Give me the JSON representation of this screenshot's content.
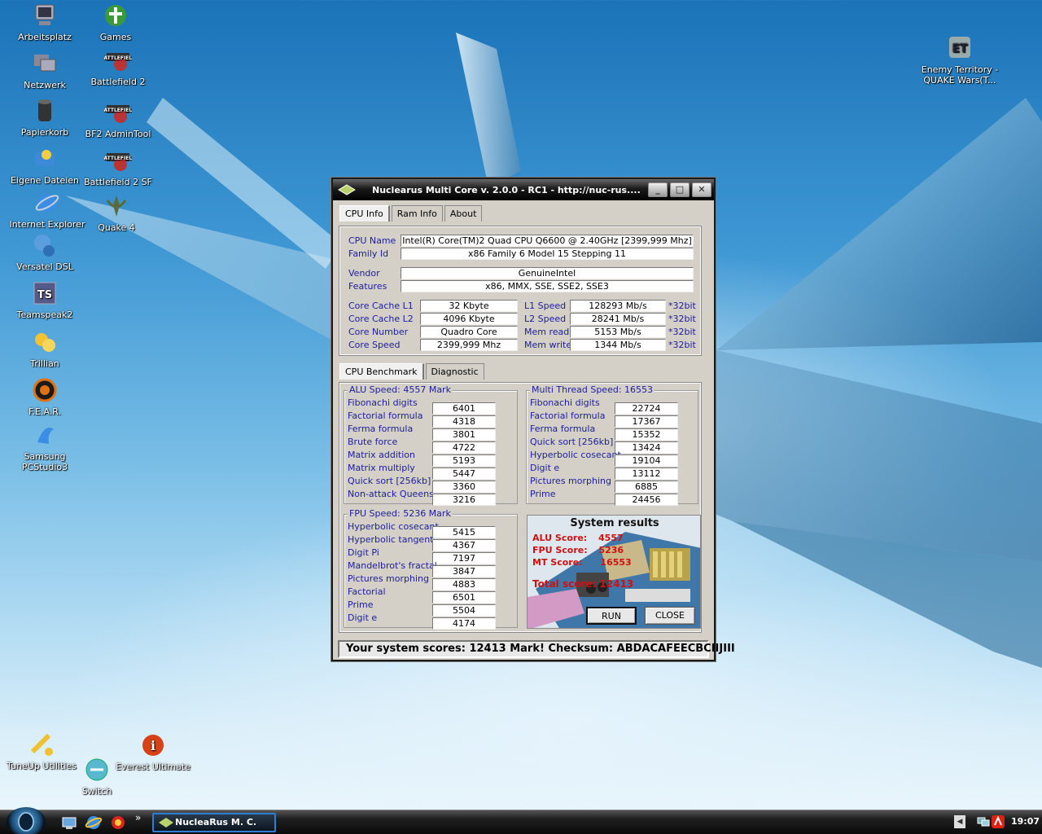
{
  "desktop": {
    "icons_left": [
      {
        "label": "Arbeitsplatz",
        "icon": "computer-icon"
      },
      {
        "label": "Netzwerk",
        "icon": "network-icon"
      },
      {
        "label": "Papierkorb",
        "icon": "recycle-bin-icon"
      },
      {
        "label": "Eigene Dateien",
        "icon": "documents-icon"
      },
      {
        "label": "Internet Explorer",
        "icon": "internet-explorer-icon"
      },
      {
        "label": "Versatel DSL",
        "icon": "dsl-icon"
      },
      {
        "label": "Teamspeak2",
        "icon": "teamspeak-icon"
      },
      {
        "label": "Trillian",
        "icon": "trillian-icon"
      },
      {
        "label": "F.E.A.R.",
        "icon": "fear-icon"
      },
      {
        "label": "Samsung PCStudio3",
        "icon": "samsung-icon"
      }
    ],
    "icons_second": [
      {
        "label": "Games",
        "icon": "games-icon"
      },
      {
        "label": "Battlefield 2",
        "icon": "battlefield-icon"
      },
      {
        "label": "BF2 AdminTool",
        "icon": "battlefield-icon"
      },
      {
        "label": "Battlefield 2 SF",
        "icon": "battlefield-icon"
      },
      {
        "label": "Quake 4",
        "icon": "quake-icon"
      }
    ],
    "icon_right": {
      "label_line1": "Enemy Territory -",
      "label_line2": "QUAKE Wars(T...",
      "icon": "enemy-territory-icon"
    },
    "icons_bottom": [
      {
        "label": "TuneUp Utilities",
        "icon": "tuneup-icon"
      },
      {
        "label": "Everest Ultimate",
        "icon": "everest-icon"
      },
      {
        "label": "Switch",
        "icon": "switch-icon"
      }
    ]
  },
  "window": {
    "title": "Nuclearus Multi Core   v. 2.0.0   -   RC1   -   http://nuc-rus....",
    "controls": {
      "minimize": "_",
      "maximize": "□",
      "close": "✕"
    },
    "tabs": [
      "CPU Info",
      "Ram Info",
      "About"
    ],
    "cpu_info": {
      "cpu_name_label": "CPU Name",
      "cpu_name": "Intel(R) Core(TM)2 Quad CPU     Q6600  @ 2.40GHz [2399,999 Mhz]",
      "family_label": "Family Id",
      "family": "x86 Family 6 Model 15 Stepping 11",
      "vendor_label": "Vendor",
      "vendor": "GenuineIntel",
      "features_label": "Features",
      "features": "x86, MMX, SSE, SSE2, SSE3",
      "l1_label": "Core Cache L1",
      "l1": "32 Kbyte",
      "l2_label": "Core Cache L2",
      "l2": "4096 Kbyte",
      "cores_label": "Core Number",
      "cores": "Quadro Core",
      "speed_label": "Core Speed",
      "speed": "2399,999 Mhz",
      "l1speed_label": "L1 Speed",
      "l1speed": "128293 Mb/s",
      "l2speed_label": "L2 Speed",
      "l2speed": "28241 Mb/s",
      "memread_label": "Mem read",
      "memread": "5153 Mb/s",
      "memwrite_label": "Mem write",
      "memwrite": "1344 Mb/s",
      "unit": "*32bit"
    },
    "subtabs": [
      "CPU Benchmark",
      "Diagnostic"
    ],
    "alu": {
      "title": "ALU Speed: 4557 Mark",
      "rows": [
        {
          "label": "Fibonachi digits",
          "value": "6401"
        },
        {
          "label": "Factorial formula",
          "value": "4318"
        },
        {
          "label": "Ferma formula",
          "value": "3801"
        },
        {
          "label": "Brute force",
          "value": "4722"
        },
        {
          "label": "Matrix addition",
          "value": "5193"
        },
        {
          "label": "Matrix multiply",
          "value": "5447"
        },
        {
          "label": "Quick sort [256kb]",
          "value": "3360"
        },
        {
          "label": "Non-attack Queens",
          "value": "3216"
        }
      ]
    },
    "mt": {
      "title": "Multi Thread Speed: 16553",
      "rows": [
        {
          "label": "Fibonachi digits",
          "value": "22724"
        },
        {
          "label": "Factorial formula",
          "value": "17367"
        },
        {
          "label": "Ferma formula",
          "value": "15352"
        },
        {
          "label": "Quick sort [256kb]",
          "value": "13424"
        },
        {
          "label": "Hyperbolic cosecant",
          "value": "19104"
        },
        {
          "label": "Digit e",
          "value": "13112"
        },
        {
          "label": "Pictures morphing",
          "value": "6885"
        },
        {
          "label": "Prime",
          "value": "24456"
        }
      ]
    },
    "fpu": {
      "title": "FPU Speed: 5236 Mark",
      "rows": [
        {
          "label": "Hyperbolic cosecant",
          "value": "5415"
        },
        {
          "label": "Hyperbolic tangent",
          "value": "4367"
        },
        {
          "label": "Digit Pi",
          "value": "7197"
        },
        {
          "label": "Mandelbrot's fractal",
          "value": "3847"
        },
        {
          "label": "Pictures morphing",
          "value": "4883"
        },
        {
          "label": "Factorial",
          "value": "6501"
        },
        {
          "label": "Prime",
          "value": "5504"
        },
        {
          "label": "Digit e",
          "value": "4174"
        }
      ]
    },
    "results": {
      "title": "System results",
      "alu_label": "ALU Score:",
      "alu": "4557",
      "fpu_label": "FPU Score:",
      "fpu": "5236",
      "mt_label": "MT Score:",
      "mt": "16553",
      "total_label": "Total score:",
      "total": "12413",
      "run": "RUN",
      "close": "CLOSE"
    },
    "status": "Your system scores: 12413 Mark!   Checksum: ABDACAFEECBCIIJIII"
  },
  "taskbar": {
    "task_label": "NucleaRus M. C.",
    "chevron": "»",
    "tray_arrow": "◀",
    "clock": "19:07"
  }
}
